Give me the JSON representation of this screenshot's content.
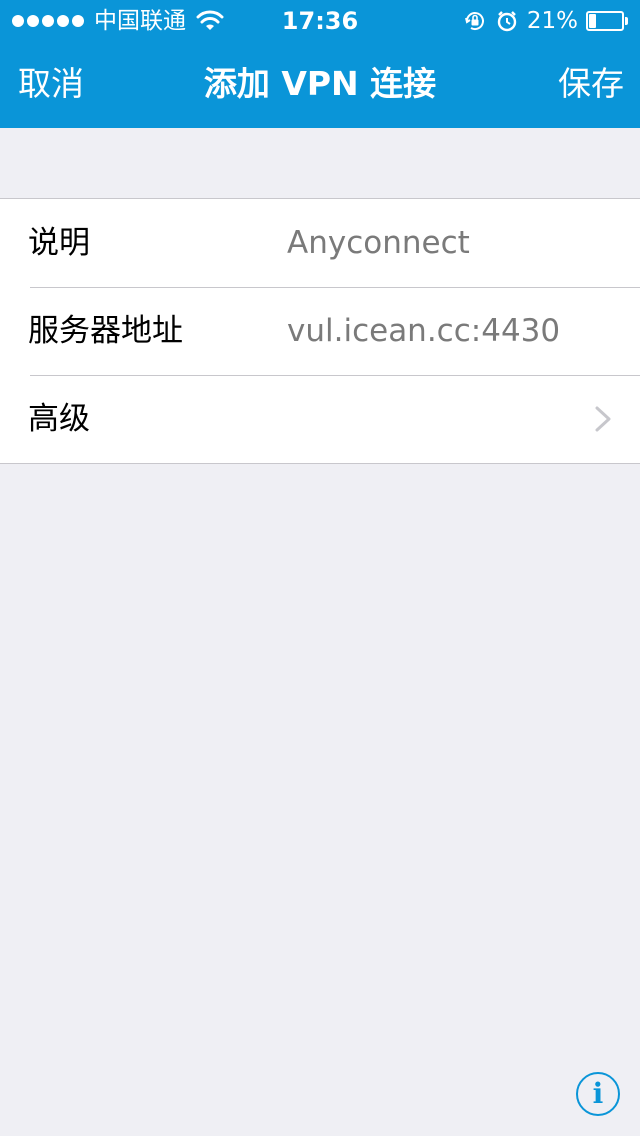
{
  "status_bar": {
    "carrier": "中国联通",
    "time": "17:36",
    "battery_percent_text": "21%",
    "battery_level": 0.21,
    "signal_dots": 5,
    "icons": [
      "wifi-icon",
      "rotation-lock-icon",
      "alarm-icon",
      "battery-icon"
    ]
  },
  "nav": {
    "cancel_label": "取消",
    "title": "添加 VPN 连接",
    "save_label": "保存"
  },
  "form": {
    "rows": [
      {
        "label": "说明",
        "value": "Anyconnect"
      },
      {
        "label": "服务器地址",
        "value": "vul.icean.cc:4430"
      },
      {
        "label": "高级"
      }
    ]
  },
  "info": {
    "label": "i"
  },
  "colors": {
    "accent": "#0a95d8",
    "background": "#efeff4",
    "value_text": "#7a7a7a",
    "separator": "#c8c7cc"
  }
}
